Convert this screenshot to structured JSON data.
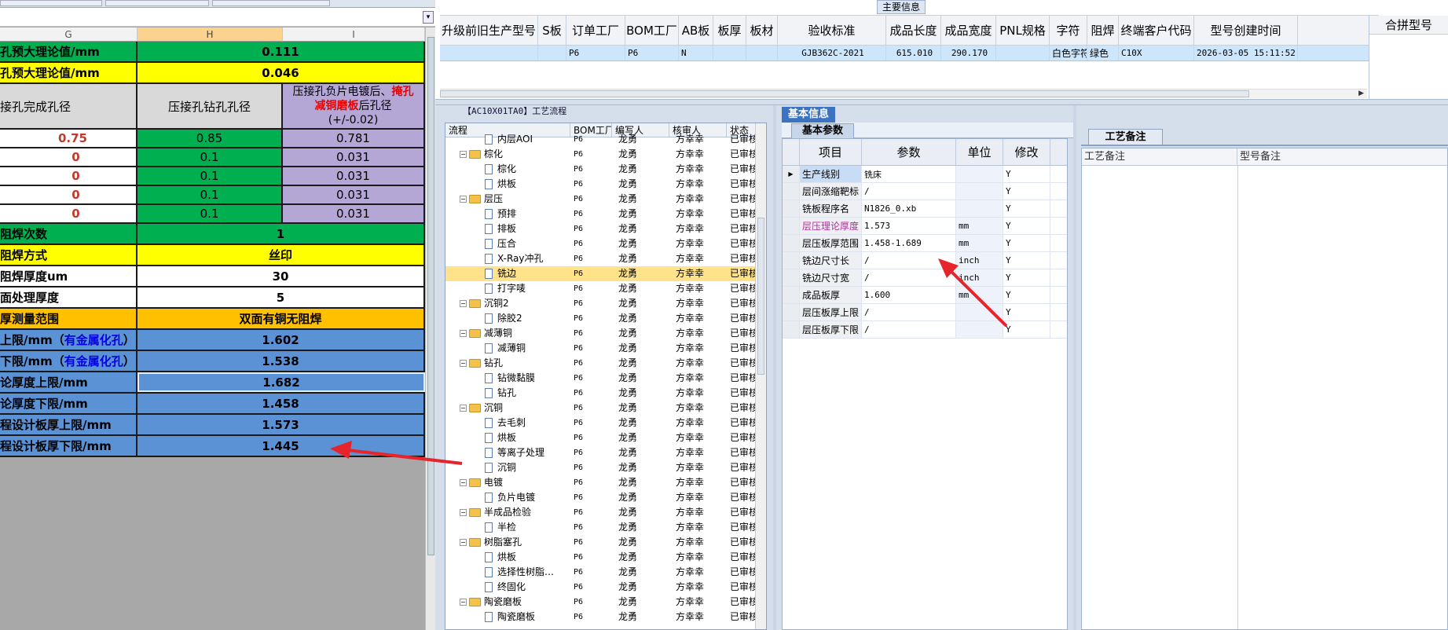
{
  "sheet": {
    "col_headers": [
      "G",
      "H",
      "I"
    ],
    "rows": [
      {
        "g": "孔预大理论值/mm",
        "h": "0.111",
        "i": null,
        "style": "g",
        "span": true
      },
      {
        "g": "孔预大理论值/mm",
        "h": "0.046",
        "i": null,
        "style": "y",
        "span": true
      },
      {
        "g": "接孔完成孔径",
        "h": "压接孔钻孔孔径",
        "i_parts": [
          "压接孔负片电镀后、",
          "掩孔",
          "减铜磨板",
          "后孔径",
          "(+/-0.02)"
        ],
        "style": "header"
      },
      {
        "g": "0.75",
        "h": "0.85",
        "i": "0.781",
        "style": "data",
        "first": true
      },
      {
        "g": "0",
        "h": "0.1",
        "i": "0.031",
        "style": "data"
      },
      {
        "g": "0",
        "h": "0.1",
        "i": "0.031",
        "style": "data"
      },
      {
        "g": "0",
        "h": "0.1",
        "i": "0.031",
        "style": "data"
      },
      {
        "g": "0",
        "h": "0.1",
        "i": "0.031",
        "style": "data"
      },
      {
        "g": "阻焊次数",
        "h": "1",
        "style": "g",
        "span": true
      },
      {
        "g": "阻焊方式",
        "h": "丝印",
        "style": "y",
        "span": true
      },
      {
        "g": "阻焊厚度um",
        "h": "30",
        "style": "w",
        "span": true
      },
      {
        "g": "面处理厚度",
        "h": "5",
        "style": "w",
        "span": true
      },
      {
        "g": "厚测量范围",
        "h": "双面有铜无阻焊",
        "style": "o",
        "span": true
      },
      {
        "g": "上限/mm（",
        "g2": "有金属化孔",
        "g3": "）",
        "h": "1.602",
        "style": "b",
        "span": true
      },
      {
        "g": "下限/mm（",
        "g2": "有金属化孔",
        "g3": "）",
        "h": "1.538",
        "style": "b",
        "span": true
      },
      {
        "g": "论厚度上限/mm",
        "h": "1.682",
        "style": "b",
        "span": true,
        "hl": true
      },
      {
        "g": "论厚度下限/mm",
        "h": "1.458",
        "style": "b",
        "span": true
      },
      {
        "g": "程设计板厚上限/mm",
        "h": "1.573",
        "style": "b",
        "span": true
      },
      {
        "g": "程设计板厚下限/mm",
        "h": "1.445",
        "style": "b",
        "span": true
      }
    ]
  },
  "main_grid": {
    "group_label": "主要信息",
    "columns": [
      "升级前旧生产型号",
      "S板",
      "订单工厂",
      "BOM工厂",
      "AB板",
      "板厚",
      "板材",
      "验收标准",
      "成品长度",
      "成品宽度",
      "PNL规格",
      "字符",
      "阻焊",
      "终端客户代码",
      "型号创建时间"
    ],
    "row": [
      "",
      "",
      "P6",
      "P6",
      "N",
      "",
      "",
      "GJB362C-2021",
      "615.010",
      "290.170",
      "",
      "白色字符",
      "绿色",
      "C10X",
      "2026-03-05 15:11:52"
    ],
    "merge_header": "合拼型号"
  },
  "process": {
    "title": "【AC10X01TA0】工艺流程",
    "headers": [
      "流程",
      "BOM工厂",
      "编写人",
      "核审人",
      "状态"
    ],
    "rows": [
      {
        "name": "内层AOI",
        "lvl": 2,
        "t": "doc",
        "bom": "P6",
        "w": "龙勇",
        "r": "方幸幸",
        "s": "已审核"
      },
      {
        "name": "棕化",
        "lvl": 1,
        "t": "fold",
        "bom": "P6",
        "w": "龙勇",
        "r": "方幸幸",
        "s": "已审核"
      },
      {
        "name": "棕化",
        "lvl": 2,
        "t": "doc",
        "bom": "P6",
        "w": "龙勇",
        "r": "方幸幸",
        "s": "已审核"
      },
      {
        "name": "烘板",
        "lvl": 2,
        "t": "doc",
        "bom": "P6",
        "w": "龙勇",
        "r": "方幸幸",
        "s": "已审核"
      },
      {
        "name": "层压",
        "lvl": 1,
        "t": "fold",
        "bom": "P6",
        "w": "龙勇",
        "r": "方幸幸",
        "s": "已审核"
      },
      {
        "name": "预排",
        "lvl": 2,
        "t": "doc",
        "bom": "P6",
        "w": "龙勇",
        "r": "方幸幸",
        "s": "已审核"
      },
      {
        "name": "排板",
        "lvl": 2,
        "t": "doc",
        "bom": "P6",
        "w": "龙勇",
        "r": "方幸幸",
        "s": "已审核"
      },
      {
        "name": "压合",
        "lvl": 2,
        "t": "doc",
        "bom": "P6",
        "w": "龙勇",
        "r": "方幸幸",
        "s": "已审核"
      },
      {
        "name": "X-Ray冲孔",
        "lvl": 2,
        "t": "doc",
        "bom": "P6",
        "w": "龙勇",
        "r": "方幸幸",
        "s": "已审核"
      },
      {
        "name": "铣边",
        "lvl": 2,
        "t": "docsel",
        "bom": "P6",
        "w": "龙勇",
        "r": "方幸幸",
        "s": "已审核",
        "sel": true
      },
      {
        "name": "打字唛",
        "lvl": 2,
        "t": "doc",
        "bom": "P6",
        "w": "龙勇",
        "r": "方幸幸",
        "s": "已审核"
      },
      {
        "name": "沉铜2",
        "lvl": 1,
        "t": "fold",
        "bom": "P6",
        "w": "龙勇",
        "r": "方幸幸",
        "s": "已审核"
      },
      {
        "name": "除胶2",
        "lvl": 2,
        "t": "doc",
        "bom": "P6",
        "w": "龙勇",
        "r": "方幸幸",
        "s": "已审核"
      },
      {
        "name": "减薄铜",
        "lvl": 1,
        "t": "fold",
        "bom": "P6",
        "w": "龙勇",
        "r": "方幸幸",
        "s": "已审核"
      },
      {
        "name": "减薄铜",
        "lvl": 2,
        "t": "doc",
        "bom": "P6",
        "w": "龙勇",
        "r": "方幸幸",
        "s": "已审核"
      },
      {
        "name": "钻孔",
        "lvl": 1,
        "t": "fold",
        "bom": "P6",
        "w": "龙勇",
        "r": "方幸幸",
        "s": "已审核"
      },
      {
        "name": "钻微黏膜",
        "lvl": 2,
        "t": "doc",
        "bom": "P6",
        "w": "龙勇",
        "r": "方幸幸",
        "s": "已审核"
      },
      {
        "name": "钻孔",
        "lvl": 2,
        "t": "doc",
        "bom": "P6",
        "w": "龙勇",
        "r": "方幸幸",
        "s": "已审核"
      },
      {
        "name": "沉铜",
        "lvl": 1,
        "t": "fold",
        "bom": "P6",
        "w": "龙勇",
        "r": "方幸幸",
        "s": "已审核"
      },
      {
        "name": "去毛刺",
        "lvl": 2,
        "t": "doc",
        "bom": "P6",
        "w": "龙勇",
        "r": "方幸幸",
        "s": "已审核"
      },
      {
        "name": "烘板",
        "lvl": 2,
        "t": "doc",
        "bom": "P6",
        "w": "龙勇",
        "r": "方幸幸",
        "s": "已审核"
      },
      {
        "name": "等离子处理",
        "lvl": 2,
        "t": "doc",
        "bom": "P6",
        "w": "龙勇",
        "r": "方幸幸",
        "s": "已审核"
      },
      {
        "name": "沉铜",
        "lvl": 2,
        "t": "doc",
        "bom": "P6",
        "w": "龙勇",
        "r": "方幸幸",
        "s": "已审核"
      },
      {
        "name": "电镀",
        "lvl": 1,
        "t": "fold",
        "bom": "P6",
        "w": "龙勇",
        "r": "方幸幸",
        "s": "已审核"
      },
      {
        "name": "负片电镀",
        "lvl": 2,
        "t": "doc",
        "bom": "P6",
        "w": "龙勇",
        "r": "方幸幸",
        "s": "已审核"
      },
      {
        "name": "半成品检验",
        "lvl": 1,
        "t": "fold",
        "bom": "P6",
        "w": "龙勇",
        "r": "方幸幸",
        "s": "已审核"
      },
      {
        "name": "半检",
        "lvl": 2,
        "t": "doc",
        "bom": "P6",
        "w": "龙勇",
        "r": "方幸幸",
        "s": "已审核"
      },
      {
        "name": "树脂塞孔",
        "lvl": 1,
        "t": "fold",
        "bom": "P6",
        "w": "龙勇",
        "r": "方幸幸",
        "s": "已审核"
      },
      {
        "name": "烘板",
        "lvl": 2,
        "t": "doc",
        "bom": "P6",
        "w": "龙勇",
        "r": "方幸幸",
        "s": "已审核"
      },
      {
        "name": "选择性树脂…",
        "lvl": 2,
        "t": "doc",
        "bom": "P6",
        "w": "龙勇",
        "r": "方幸幸",
        "s": "已审核"
      },
      {
        "name": "终固化",
        "lvl": 2,
        "t": "doc",
        "bom": "P6",
        "w": "龙勇",
        "r": "方幸幸",
        "s": "已审核"
      },
      {
        "name": "陶瓷磨板",
        "lvl": 1,
        "t": "fold",
        "bom": "P6",
        "w": "龙勇",
        "r": "方幸幸",
        "s": "已审核"
      },
      {
        "name": "陶瓷磨板",
        "lvl": 2,
        "t": "doc",
        "bom": "P6",
        "w": "龙勇",
        "r": "方幸幸",
        "s": "已审核"
      }
    ]
  },
  "basic": {
    "tab": "基本信息",
    "subtab": "基本参数",
    "headers": [
      "项目",
      "参数",
      "单位",
      "修改"
    ],
    "rows": [
      {
        "item": "生产线别",
        "param": "铣床",
        "unit": "",
        "mod": "Y",
        "cur": true
      },
      {
        "item": "层间涨缩靶标",
        "param": "/",
        "unit": "",
        "mod": "Y"
      },
      {
        "item": "铣板程序名",
        "param": "N1826_0.xb",
        "unit": "",
        "mod": "Y"
      },
      {
        "item": "层压理论厚度",
        "param": "1.573",
        "unit": "mm",
        "mod": "Y",
        "purple": true
      },
      {
        "item": "层压板厚范围",
        "param": "1.458-1.689",
        "unit": "mm",
        "mod": "Y"
      },
      {
        "item": "铣边尺寸长",
        "param": "/",
        "unit": "inch",
        "mod": "Y"
      },
      {
        "item": "铣边尺寸宽",
        "param": "/",
        "unit": "inch",
        "mod": "Y"
      },
      {
        "item": "成品板厚",
        "param": "1.600",
        "unit": "mm",
        "mod": "Y"
      },
      {
        "item": "层压板厚上限",
        "param": "/",
        "unit": "",
        "mod": "Y"
      },
      {
        "item": "层压板厚下限",
        "param": "/",
        "unit": "",
        "mod": "Y"
      }
    ]
  },
  "remarks": {
    "tab": "工艺备注",
    "headers": [
      "工艺备注",
      "型号备注"
    ]
  },
  "colors": {
    "arrow": "#e8242b"
  }
}
